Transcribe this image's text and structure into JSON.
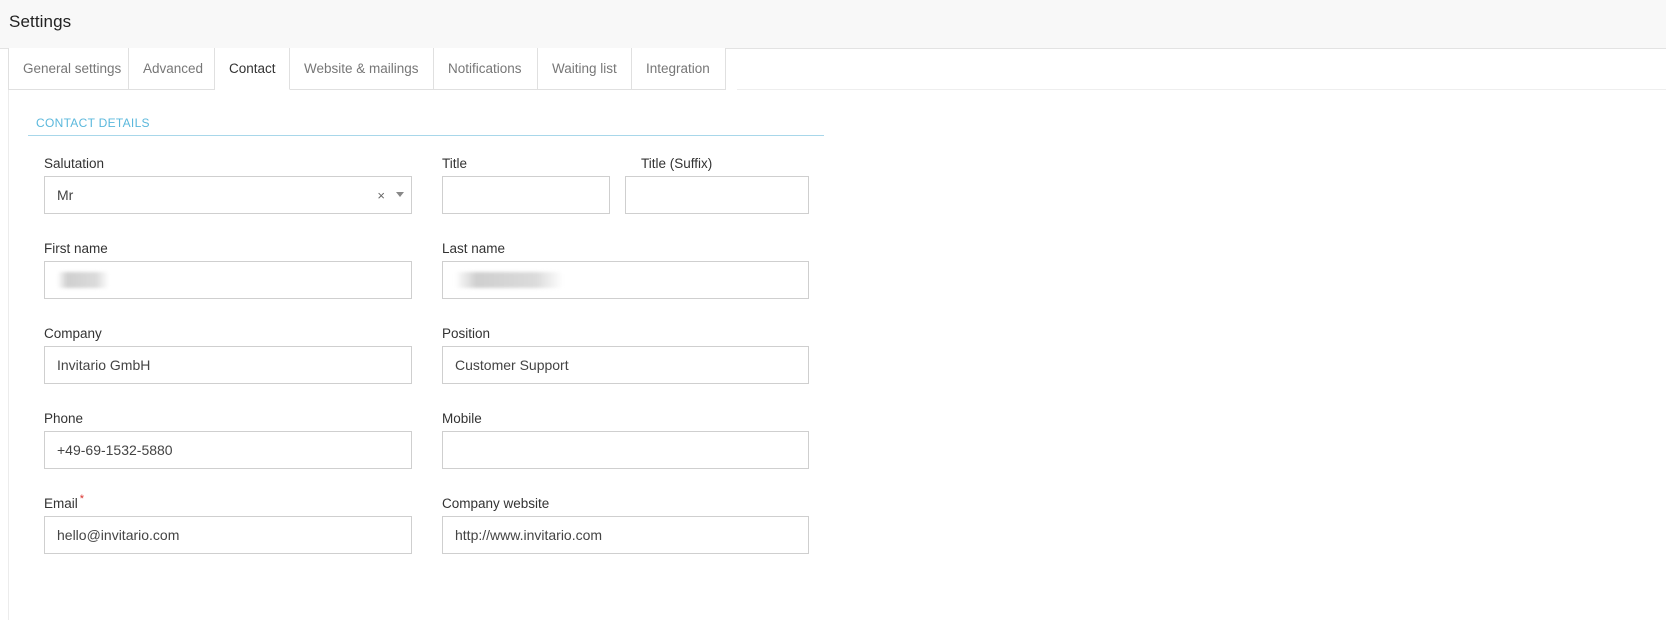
{
  "header": {
    "title": "Settings"
  },
  "tabs": [
    {
      "label": "General settings",
      "active": false
    },
    {
      "label": "Advanced",
      "active": false
    },
    {
      "label": "Contact",
      "active": true
    },
    {
      "label": "Website & mailings",
      "active": false
    },
    {
      "label": "Notifications",
      "active": false
    },
    {
      "label": "Waiting list",
      "active": false
    },
    {
      "label": "Integration",
      "active": false
    }
  ],
  "section": {
    "title": "CONTACT DETAILS"
  },
  "fields": {
    "salutation": {
      "label": "Salutation",
      "value": "Mr",
      "clear_icon": "×"
    },
    "title": {
      "label": "Title",
      "value": ""
    },
    "title_suffix": {
      "label": "Title (Suffix)",
      "value": ""
    },
    "first_name": {
      "label": "First name",
      "value": ""
    },
    "last_name": {
      "label": "Last name",
      "value": ""
    },
    "company": {
      "label": "Company",
      "value": "Invitario GmbH"
    },
    "position": {
      "label": "Position",
      "value": "Customer Support"
    },
    "phone": {
      "label": "Phone",
      "value": "+49-69-1532-5880"
    },
    "mobile": {
      "label": "Mobile",
      "value": ""
    },
    "email": {
      "label": "Email",
      "required_mark": "*",
      "value": "hello@invitario.com"
    },
    "company_website": {
      "label": "Company website",
      "value": "http://www.invitario.com"
    }
  },
  "colors": {
    "accent": "#5bb8dc",
    "required": "#d9312c",
    "border": "#cfcfcf"
  }
}
